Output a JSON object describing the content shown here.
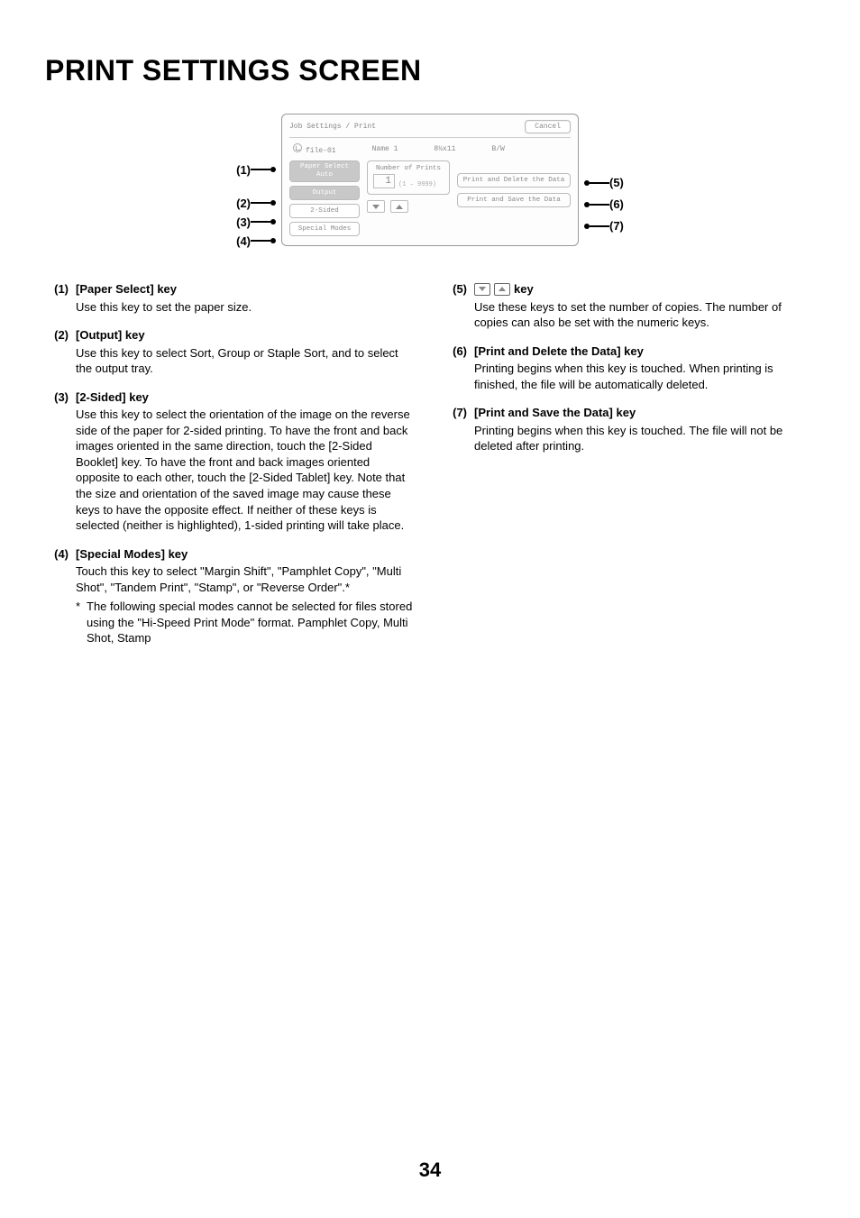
{
  "title": "PRINT SETTINGS SCREEN",
  "page_number": "34",
  "screen": {
    "header_title": "Job Settings / Print",
    "cancel": "Cancel",
    "file_name": "file-01",
    "user": "Name 1",
    "size": "8½x11",
    "mode": "B/W",
    "paper_select_label": "Paper Select",
    "paper_select_value": "Auto",
    "output": "Output",
    "two_sided": "2-Sided",
    "special_modes": "Special Modes",
    "num_prints_label": "Number of Prints",
    "num_prints_value": "1",
    "num_prints_range": "(1 – 9999)",
    "print_delete": "Print and Delete the Data",
    "print_save": "Print and Save the Data"
  },
  "left_list": [
    {
      "num": "(1)",
      "title": "[Paper Select] key",
      "text": "Use this key to set the paper size."
    },
    {
      "num": "(2)",
      "title": "[Output] key",
      "text": "Use this key to select Sort, Group or Staple Sort, and to select the output tray."
    },
    {
      "num": "(3)",
      "title": "[2-Sided] key",
      "text": "Use this key to select the orientation of the image on the reverse side of the paper for 2-sided printing. To have the front and back images oriented in the same direction, touch the [2-Sided Booklet] key. To have the front and back images oriented opposite to each other, touch the [2-Sided Tablet] key. Note that the size and orientation of the saved image may cause these keys to have the opposite effect. If neither of these keys is selected (neither is highlighted), 1-sided printing will take place."
    },
    {
      "num": "(4)",
      "title": "[Special Modes] key",
      "text": "Touch this key to select \"Margin Shift\", \"Pamphlet Copy\", \"Multi Shot\", \"Tandem Print\", \"Stamp\", or \"Reverse Order\".*",
      "footnote": "The following special modes cannot be selected for files stored using the \"Hi-Speed Print Mode\" format. Pamphlet Copy, Multi Shot, Stamp"
    }
  ],
  "right_list": [
    {
      "num": "(5)",
      "title_suffix": " key",
      "text": "Use these keys to set the number of copies. The number of copies can also be set with the numeric keys."
    },
    {
      "num": "(6)",
      "title": "[Print and Delete the Data] key",
      "text": "Printing begins when this key is touched. When printing is finished, the file will be automatically deleted."
    },
    {
      "num": "(7)",
      "title": "[Print and Save the Data] key",
      "text": "Printing begins when this key is touched. The file will not be deleted after printing."
    }
  ],
  "callouts_left": [
    "(1)",
    "(2)",
    "(3)",
    "(4)"
  ],
  "callouts_right": [
    "(5)",
    "(6)",
    "(7)"
  ]
}
